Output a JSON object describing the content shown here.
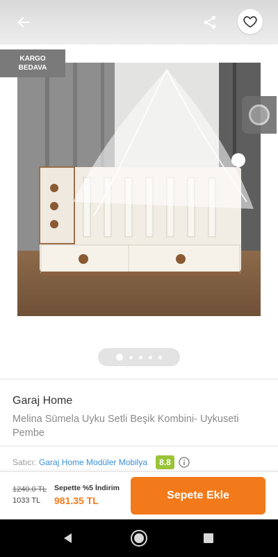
{
  "header": {
    "back_icon": "arrow-left-icon",
    "share_icon": "share-icon",
    "favorite_icon": "heart-outline-icon"
  },
  "gallery": {
    "badge_line1": "KARGO",
    "badge_line2": "BEDAVA",
    "image_count": 5,
    "active_index": 0
  },
  "product": {
    "brand": "Garaj Home",
    "name": "Melina Sümela Uyku Setli Beşik Kombini- Uykuseti Pembe"
  },
  "seller": {
    "label": "Satıcı:",
    "name": "Garaj Home Modüler Mobilya",
    "rating": "8.8"
  },
  "pricing": {
    "old_price": "1240.0 TL",
    "base_price": "1033 TL",
    "promo_label": "Sepette %5 İndirim",
    "final_price": "981.35 TL",
    "add_to_cart": "Sepete Ekle"
  },
  "colors": {
    "accent": "#f27a1a",
    "link": "#3b8fd6",
    "rating": "#9bc43a"
  }
}
